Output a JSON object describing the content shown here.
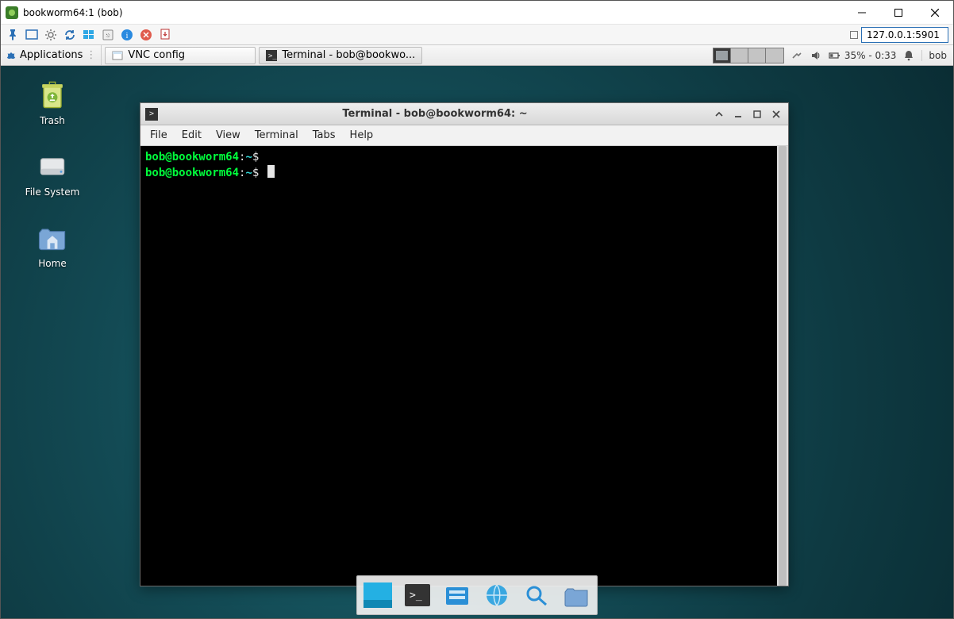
{
  "host_window": {
    "title": "bookworm64:1 (bob)"
  },
  "vnc": {
    "address": "127.0.0.1:5901"
  },
  "panel": {
    "apps_label": "Applications",
    "taskbar": [
      {
        "label": "VNC config",
        "icon": "vnc"
      },
      {
        "label": "Terminal - bob@bookwo...",
        "icon": "terminal"
      }
    ],
    "battery_text": "35% - 0:33",
    "user": "bob"
  },
  "desktop_icons": [
    {
      "name": "Trash"
    },
    {
      "name": "File System"
    },
    {
      "name": "Home"
    }
  ],
  "terminal": {
    "title": "Terminal - bob@bookworm64: ~",
    "menu": [
      "File",
      "Edit",
      "View",
      "Terminal",
      "Tabs",
      "Help"
    ],
    "lines": [
      {
        "user_host": "bob@bookworm64",
        "sep": ":",
        "cwd": "~",
        "prompt": "$",
        "cmd": ""
      },
      {
        "user_host": "bob@bookworm64",
        "sep": ":",
        "cwd": "~",
        "prompt": "$",
        "cmd": "",
        "cursor": true
      }
    ]
  }
}
